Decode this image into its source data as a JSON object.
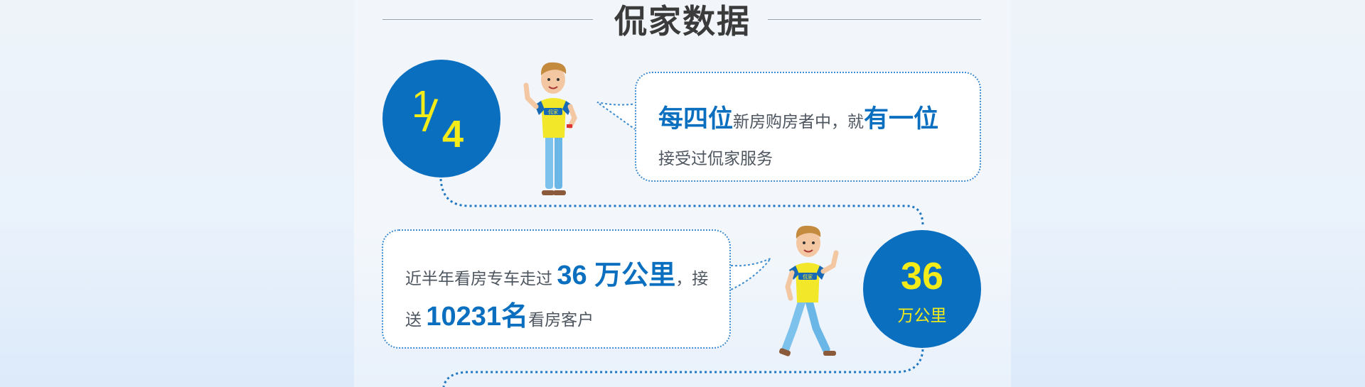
{
  "section_title": "侃家数据",
  "stat1": {
    "fraction_numerator": "1",
    "fraction_denominator": "4",
    "text_highlight_start": "每四位",
    "text_middle": "新房购房者中，就",
    "text_highlight_end": "有一位",
    "text_line2": "接受过侃家服务"
  },
  "stat2": {
    "circle_value": "36",
    "circle_unit": "万公里",
    "text_start": "近半年看房专车走过",
    "text_highlight1": "36 万公里",
    "text_after1": "，接",
    "text_line2_start": "送",
    "text_highlight2": "10231名",
    "text_end": "看房客户"
  },
  "mascot_shirt_logo": "侃家",
  "colors": {
    "brand_blue": "#0b6fc0",
    "highlight_yellow": "#f4ec19",
    "shirt_yellow": "#f2e829",
    "pants_blue": "#7cc2ec"
  }
}
